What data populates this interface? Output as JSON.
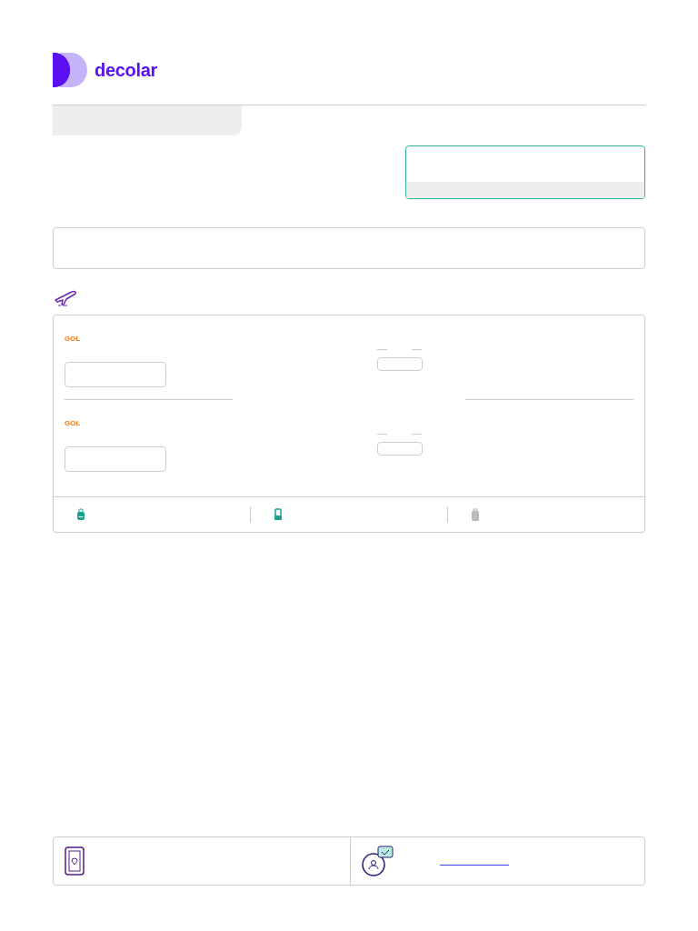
{
  "brand": {
    "name": "decolar"
  },
  "segments": [
    {
      "airline": "GOL"
    },
    {
      "airline": "GOL"
    }
  ],
  "baggage": [
    {
      "kind": "backpack",
      "included": true
    },
    {
      "kind": "carry-on",
      "included": true
    },
    {
      "kind": "suitcase",
      "included": false
    }
  ]
}
